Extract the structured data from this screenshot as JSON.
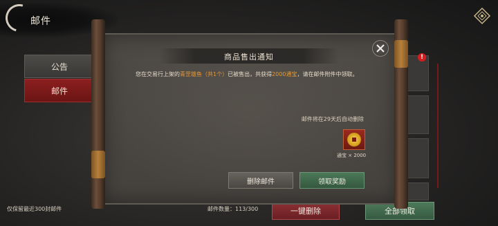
{
  "header": {
    "title": "邮件"
  },
  "tabs": [
    {
      "label": "公告"
    },
    {
      "label": "邮件"
    }
  ],
  "right_list": {
    "badge": "!"
  },
  "modal": {
    "title": "商品售出通知",
    "body": {
      "part1": "您在交易行上架的",
      "item": "青罡雄鱼（共1个）",
      "part2": "已被售出，共获得",
      "amount": "2000通宝",
      "part3": "，请在邮件附件中领取。"
    },
    "expire_note": "邮件将在29天后自动删除",
    "reward": {
      "label": "通宝 × 2000",
      "icon": "coin-icon"
    },
    "delete_button": "删除邮件",
    "claim_button": "领取奖励"
  },
  "footer": {
    "keep_note": "仅保留最近300封邮件",
    "count_label": "邮件数量：113/300",
    "delete_all": "一键删除",
    "claim_all": "全部领取"
  },
  "colors": {
    "highlight": "#e39a3b",
    "tab_active": "#8c1f1f",
    "claim_green": "#4b7857",
    "delete_red": "#8d3034"
  }
}
